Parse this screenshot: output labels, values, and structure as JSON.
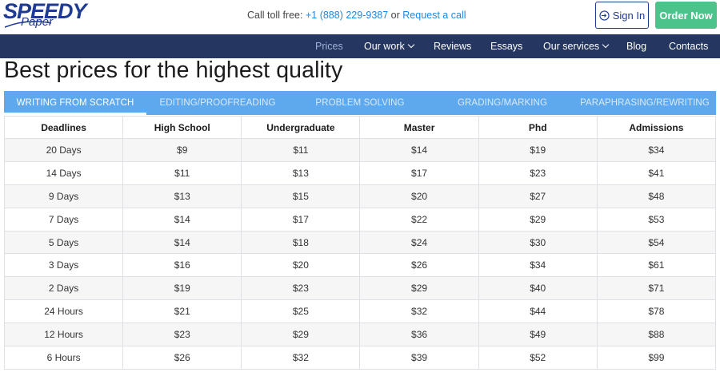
{
  "brand": {
    "logo_line1": "SPEEDY",
    "logo_line2": "Paper",
    "brand_color": "#1f3a93"
  },
  "header": {
    "call_label": "Call toll free:",
    "phone": "+1 (888) 229-9387",
    "or_text": "or",
    "request_call": "Request a call",
    "sign_in": "Sign In",
    "order_now": "Order Now",
    "order_color": "#4cc38a"
  },
  "nav": {
    "bg_color": "#253761",
    "items": [
      {
        "label": "Prices",
        "active": true
      },
      {
        "label": "Our work",
        "dropdown": true
      },
      {
        "label": "Reviews"
      },
      {
        "label": "Essays"
      },
      {
        "label": "Our services",
        "dropdown": true
      },
      {
        "label": "Blog"
      },
      {
        "label": "Contacts"
      }
    ]
  },
  "page": {
    "title": "Best prices for the highest quality"
  },
  "tabs": {
    "bg_color": "#5ea8ee",
    "items": [
      {
        "label": "WRITING FROM SCRATCH",
        "active": true
      },
      {
        "label": "EDITING/PROOFREADING"
      },
      {
        "label": "PROBLEM SOLVING"
      },
      {
        "label": "GRADING/MARKING"
      },
      {
        "label": "PARAPHRASING/REWRITING"
      }
    ]
  },
  "table": {
    "columns": [
      "Deadlines",
      "High School",
      "Undergraduate",
      "Master",
      "Phd",
      "Admissions"
    ],
    "rows": [
      [
        "20 Days",
        "$9",
        "$11",
        "$14",
        "$19",
        "$34"
      ],
      [
        "14 Days",
        "$11",
        "$13",
        "$17",
        "$23",
        "$41"
      ],
      [
        "9 Days",
        "$13",
        "$15",
        "$20",
        "$27",
        "$48"
      ],
      [
        "7 Days",
        "$14",
        "$17",
        "$22",
        "$29",
        "$53"
      ],
      [
        "5 Days",
        "$14",
        "$18",
        "$24",
        "$30",
        "$54"
      ],
      [
        "3 Days",
        "$16",
        "$20",
        "$26",
        "$34",
        "$61"
      ],
      [
        "2 Days",
        "$19",
        "$23",
        "$29",
        "$40",
        "$71"
      ],
      [
        "24 Hours",
        "$21",
        "$25",
        "$32",
        "$44",
        "$78"
      ],
      [
        "12 Hours",
        "$23",
        "$29",
        "$36",
        "$49",
        "$88"
      ],
      [
        "6 Hours",
        "$26",
        "$32",
        "$39",
        "$52",
        "$99"
      ]
    ]
  }
}
